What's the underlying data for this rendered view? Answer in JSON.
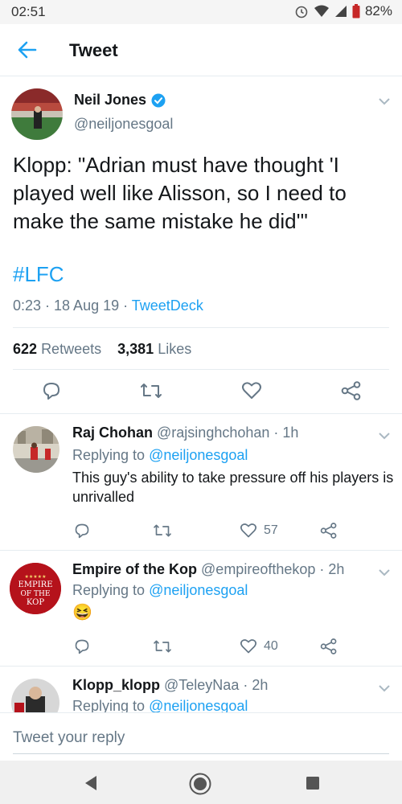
{
  "status_bar": {
    "time": "02:51",
    "battery": "82%"
  },
  "app_bar": {
    "title": "Tweet"
  },
  "tweet": {
    "author_name": "Neil Jones",
    "author_handle": "@neiljonesgoal",
    "text": "Klopp: \"Adrian must have thought 'I played well like Alisson, so I need to make the same mistake he did'\"",
    "hashtag": "#LFC",
    "time": "0:23 · 18 Aug 19 · ",
    "source": "TweetDeck",
    "retweets_count": "622",
    "retweets_label": "Retweets",
    "likes_count": "3,381",
    "likes_label": "Likes"
  },
  "replies": [
    {
      "name": "Raj Chohan",
      "handle": "@rajsinghchohan",
      "time": "· 1h",
      "replying_prefix": "Replying to ",
      "replying_to": "@neiljonesgoal",
      "text": "This guy's ability to take pressure off his players is unrivalled",
      "likes": "57"
    },
    {
      "name": "Empire of the Kop",
      "handle": "@empireofthekop",
      "time": "· 2h",
      "replying_prefix": "Replying to ",
      "replying_to": "@neiljonesgoal",
      "text": "😆",
      "likes": "40",
      "avatar_text": "EMPIRE OF THE KOP"
    },
    {
      "name": "Klopp_klopp",
      "handle": "@TeleyNaa",
      "time": "· 2h",
      "replying_prefix": "Replying to ",
      "replying_to": "@neiljonesgoal"
    }
  ],
  "compose": {
    "placeholder": "Tweet your reply"
  },
  "colors": {
    "accent": "#1da1f2",
    "secondary_text": "#657786",
    "divider": "#e6ecf0",
    "verified": "#1da1f2",
    "lfc_red": "#b5121b"
  }
}
